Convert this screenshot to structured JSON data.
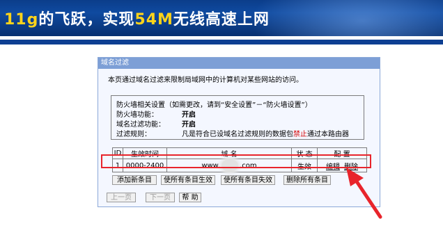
{
  "banner": {
    "title_prefix": "11g",
    "title_mid": "的飞跃，实现",
    "title_speed": "54M",
    "title_suffix": "无线高速上网"
  },
  "panel": {
    "title": "域名过滤",
    "description": "本页通过域名过滤来限制局域网中的计算机对某些网站的访问。"
  },
  "settings": {
    "line1": "防火墙相关设置（如需更改，请到“安全设置”－“防火墙设置”）",
    "firewall_label": "防火墙功能：",
    "firewall_value": "开启",
    "domain_filter_label": "域名过滤功能：",
    "domain_filter_value": "开启",
    "rule_label": "过滤规则：",
    "rule_text_before": "凡是符合已设域名过滤规则的数据包",
    "rule_text_forbid": "禁止",
    "rule_text_after": "通过本路由器"
  },
  "table": {
    "headers": {
      "id": "ID",
      "time": "生效时间",
      "domain": "域 名",
      "status": "状 态",
      "config": "配 置"
    },
    "rows": [
      {
        "id": "1",
        "time": "0000-2400",
        "domain_prefix": "www.",
        "domain_suffix": ".com",
        "status": "生效",
        "edit": "编辑",
        "delete": "删除"
      }
    ]
  },
  "buttons": {
    "add": "添加新条目",
    "enable_all": "使所有条目生效",
    "disable_all": "使所有条目失效",
    "delete_all": "删除所有条目",
    "prev": "上一页",
    "next": "下一页",
    "help": "帮 助"
  },
  "colors": {
    "highlight": "#e8242b",
    "banner": "#0b3d8a",
    "panel_header": "#7d9fd6"
  }
}
